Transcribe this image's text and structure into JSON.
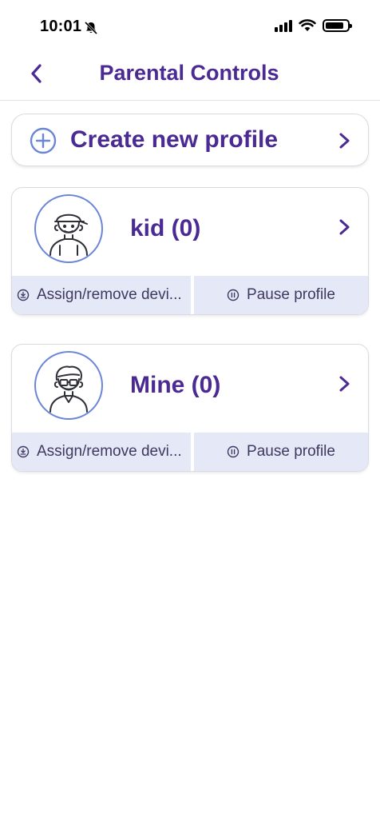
{
  "status_bar": {
    "time": "10:01",
    "battery_level": 0.85
  },
  "nav": {
    "back_icon": "chevron-left-icon",
    "title": "Parental Controls"
  },
  "create_profile": {
    "icon": "plus-circle-icon",
    "label": "Create new profile"
  },
  "profiles": [
    {
      "name": "kid (0)",
      "avatar": "kid-avatar-icon",
      "assign_label": "Assign/remove devi...",
      "pause_label": "Pause profile"
    },
    {
      "name": "Mine (0)",
      "avatar": "adult-avatar-icon",
      "assign_label": "Assign/remove devi...",
      "pause_label": "Pause profile"
    }
  ],
  "colors": {
    "brand_purple": "#4b2b93",
    "avatar_ring": "#6b86d6",
    "action_bar_bg": "#e5e8f7"
  }
}
